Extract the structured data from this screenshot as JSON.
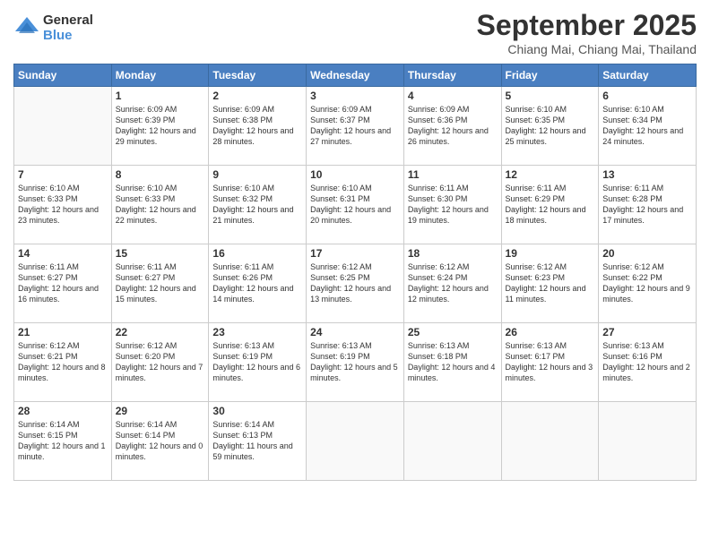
{
  "logo": {
    "general": "General",
    "blue": "Blue"
  },
  "title": "September 2025",
  "location": "Chiang Mai, Chiang Mai, Thailand",
  "weekdays": [
    "Sunday",
    "Monday",
    "Tuesday",
    "Wednesday",
    "Thursday",
    "Friday",
    "Saturday"
  ],
  "weeks": [
    [
      {
        "day": "",
        "info": ""
      },
      {
        "day": "1",
        "info": "Sunrise: 6:09 AM\nSunset: 6:39 PM\nDaylight: 12 hours\nand 29 minutes."
      },
      {
        "day": "2",
        "info": "Sunrise: 6:09 AM\nSunset: 6:38 PM\nDaylight: 12 hours\nand 28 minutes."
      },
      {
        "day": "3",
        "info": "Sunrise: 6:09 AM\nSunset: 6:37 PM\nDaylight: 12 hours\nand 27 minutes."
      },
      {
        "day": "4",
        "info": "Sunrise: 6:09 AM\nSunset: 6:36 PM\nDaylight: 12 hours\nand 26 minutes."
      },
      {
        "day": "5",
        "info": "Sunrise: 6:10 AM\nSunset: 6:35 PM\nDaylight: 12 hours\nand 25 minutes."
      },
      {
        "day": "6",
        "info": "Sunrise: 6:10 AM\nSunset: 6:34 PM\nDaylight: 12 hours\nand 24 minutes."
      }
    ],
    [
      {
        "day": "7",
        "info": "Sunrise: 6:10 AM\nSunset: 6:33 PM\nDaylight: 12 hours\nand 23 minutes."
      },
      {
        "day": "8",
        "info": "Sunrise: 6:10 AM\nSunset: 6:33 PM\nDaylight: 12 hours\nand 22 minutes."
      },
      {
        "day": "9",
        "info": "Sunrise: 6:10 AM\nSunset: 6:32 PM\nDaylight: 12 hours\nand 21 minutes."
      },
      {
        "day": "10",
        "info": "Sunrise: 6:10 AM\nSunset: 6:31 PM\nDaylight: 12 hours\nand 20 minutes."
      },
      {
        "day": "11",
        "info": "Sunrise: 6:11 AM\nSunset: 6:30 PM\nDaylight: 12 hours\nand 19 minutes."
      },
      {
        "day": "12",
        "info": "Sunrise: 6:11 AM\nSunset: 6:29 PM\nDaylight: 12 hours\nand 18 minutes."
      },
      {
        "day": "13",
        "info": "Sunrise: 6:11 AM\nSunset: 6:28 PM\nDaylight: 12 hours\nand 17 minutes."
      }
    ],
    [
      {
        "day": "14",
        "info": "Sunrise: 6:11 AM\nSunset: 6:27 PM\nDaylight: 12 hours\nand 16 minutes."
      },
      {
        "day": "15",
        "info": "Sunrise: 6:11 AM\nSunset: 6:27 PM\nDaylight: 12 hours\nand 15 minutes."
      },
      {
        "day": "16",
        "info": "Sunrise: 6:11 AM\nSunset: 6:26 PM\nDaylight: 12 hours\nand 14 minutes."
      },
      {
        "day": "17",
        "info": "Sunrise: 6:12 AM\nSunset: 6:25 PM\nDaylight: 12 hours\nand 13 minutes."
      },
      {
        "day": "18",
        "info": "Sunrise: 6:12 AM\nSunset: 6:24 PM\nDaylight: 12 hours\nand 12 minutes."
      },
      {
        "day": "19",
        "info": "Sunrise: 6:12 AM\nSunset: 6:23 PM\nDaylight: 12 hours\nand 11 minutes."
      },
      {
        "day": "20",
        "info": "Sunrise: 6:12 AM\nSunset: 6:22 PM\nDaylight: 12 hours\nand 9 minutes."
      }
    ],
    [
      {
        "day": "21",
        "info": "Sunrise: 6:12 AM\nSunset: 6:21 PM\nDaylight: 12 hours\nand 8 minutes."
      },
      {
        "day": "22",
        "info": "Sunrise: 6:12 AM\nSunset: 6:20 PM\nDaylight: 12 hours\nand 7 minutes."
      },
      {
        "day": "23",
        "info": "Sunrise: 6:13 AM\nSunset: 6:19 PM\nDaylight: 12 hours\nand 6 minutes."
      },
      {
        "day": "24",
        "info": "Sunrise: 6:13 AM\nSunset: 6:19 PM\nDaylight: 12 hours\nand 5 minutes."
      },
      {
        "day": "25",
        "info": "Sunrise: 6:13 AM\nSunset: 6:18 PM\nDaylight: 12 hours\nand 4 minutes."
      },
      {
        "day": "26",
        "info": "Sunrise: 6:13 AM\nSunset: 6:17 PM\nDaylight: 12 hours\nand 3 minutes."
      },
      {
        "day": "27",
        "info": "Sunrise: 6:13 AM\nSunset: 6:16 PM\nDaylight: 12 hours\nand 2 minutes."
      }
    ],
    [
      {
        "day": "28",
        "info": "Sunrise: 6:14 AM\nSunset: 6:15 PM\nDaylight: 12 hours\nand 1 minute."
      },
      {
        "day": "29",
        "info": "Sunrise: 6:14 AM\nSunset: 6:14 PM\nDaylight: 12 hours\nand 0 minutes."
      },
      {
        "day": "30",
        "info": "Sunrise: 6:14 AM\nSunset: 6:13 PM\nDaylight: 11 hours\nand 59 minutes."
      },
      {
        "day": "",
        "info": ""
      },
      {
        "day": "",
        "info": ""
      },
      {
        "day": "",
        "info": ""
      },
      {
        "day": "",
        "info": ""
      }
    ]
  ]
}
